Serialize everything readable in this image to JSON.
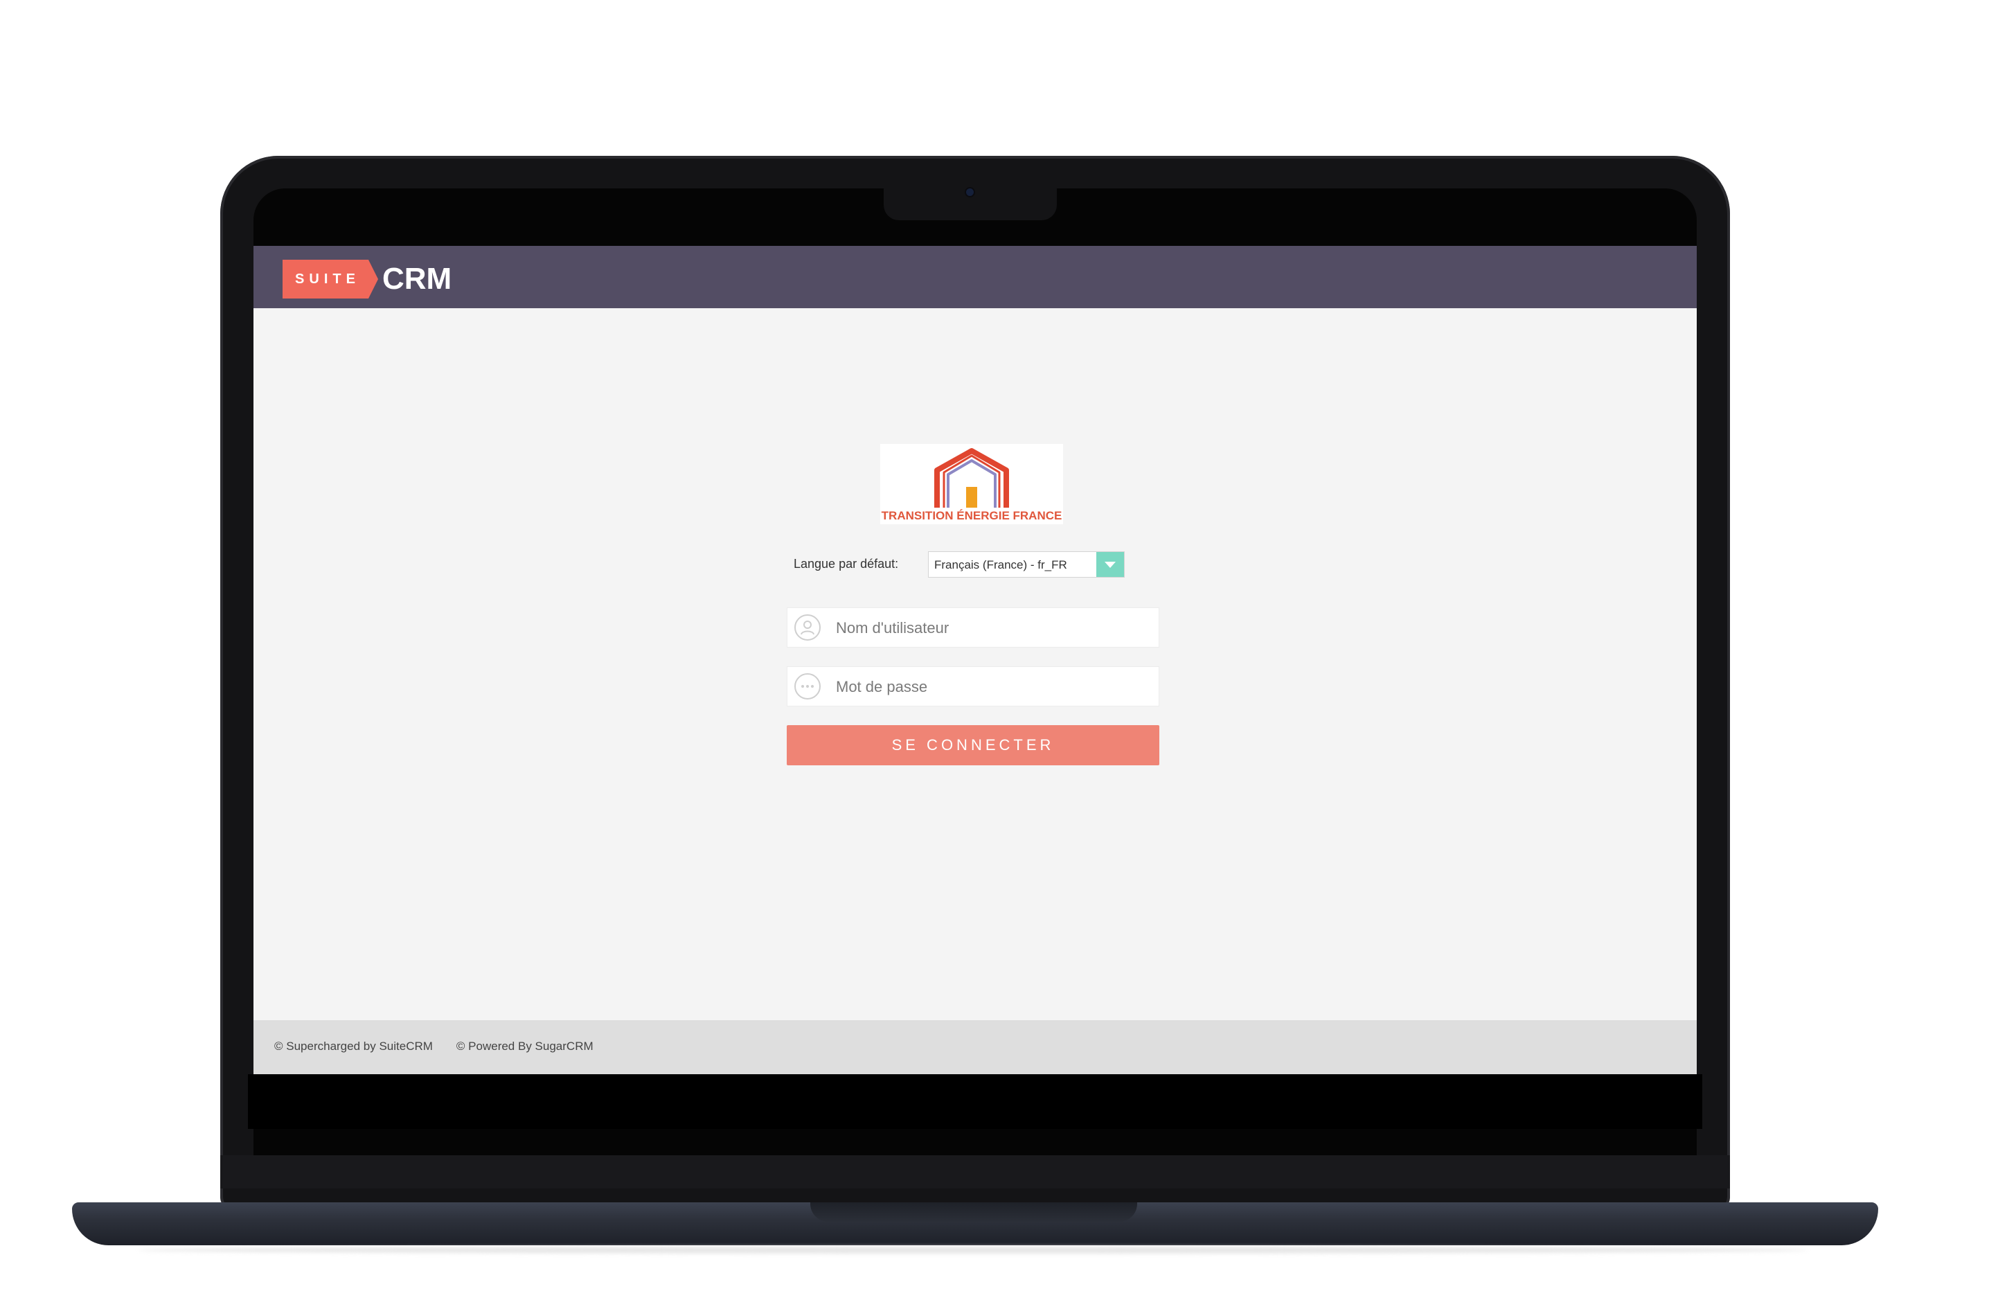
{
  "header": {
    "brand_suite": "SUITE",
    "brand_crm": "CRM"
  },
  "logo": {
    "company_name": "TRANSITION ÉNERGIE FRANCE",
    "icon": "house-logo-icon"
  },
  "login_form": {
    "language_label": "Langue par défaut:",
    "language_selected": "Français (France) - fr_FR",
    "username_placeholder": "Nom d'utilisateur",
    "username_value": "",
    "username_icon": "user-icon",
    "password_placeholder": "Mot de passe",
    "password_value": "",
    "password_icon": "password-dots-icon",
    "submit_label": "SE CONNECTER"
  },
  "footer": {
    "supercharged": "© Supercharged by SuiteCRM",
    "powered": "© Powered By SugarCRM"
  },
  "colors": {
    "header_bg": "#534d64",
    "brand_accent": "#f0685a",
    "button_bg": "#ef8475",
    "select_arrow_bg": "#7ad8c2",
    "page_bg": "#f4f4f4",
    "footer_bg": "#dedede"
  }
}
